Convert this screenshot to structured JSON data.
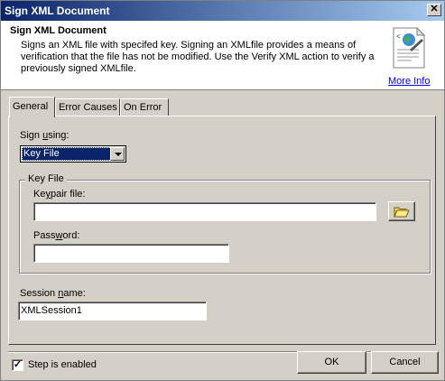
{
  "window": {
    "title": "Sign XML Document",
    "close_glyph": "✕"
  },
  "header": {
    "title": "Sign XML Document",
    "description": "Signs an XML file with specifed key. Signing an XMLfile provides a means of verification that the file has not be modified.  Use the Verify XML action to verify a previously signed XMLfile.",
    "icon": "xml-document-icon",
    "more_info": "More Info"
  },
  "tabs": [
    {
      "label": "General",
      "active": true
    },
    {
      "label": "Error Causes",
      "active": false
    },
    {
      "label": "On Error",
      "active": false
    }
  ],
  "sign_using": {
    "label_pre": "Sign ",
    "label_u": "u",
    "label_post": "sing:",
    "value": "Key File"
  },
  "key_file_group": {
    "legend": "Key File",
    "keypair": {
      "label_pre": "Ke",
      "label_u": "y",
      "label_post": "pair file:",
      "value": "",
      "browse_icon": "folder-open-icon"
    },
    "password": {
      "label_pre": "Pass",
      "label_u": "w",
      "label_post": "ord:",
      "value": ""
    }
  },
  "session_name": {
    "label_pre": "Session ",
    "label_u": "n",
    "label_post": "ame:",
    "value": "XMLSession1"
  },
  "footer": {
    "step_enabled": {
      "label": "Step is enabled",
      "checked": true
    },
    "ok_label": "OK",
    "cancel_label": "Cancel"
  },
  "colors": {
    "title_start": "#0a246a",
    "title_end": "#a6caf0",
    "link": "#0000ff",
    "selection": "#0a246a",
    "face": "#d4d0c8"
  }
}
